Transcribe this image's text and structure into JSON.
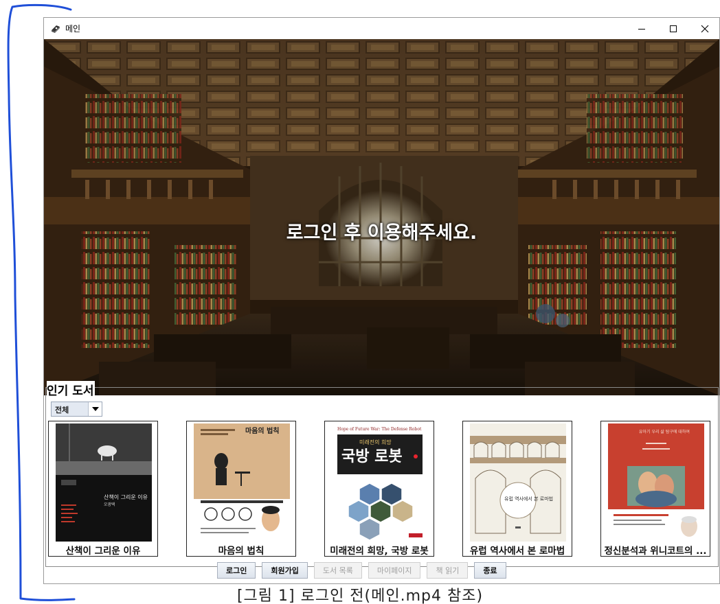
{
  "window": {
    "title": "메인"
  },
  "hero": {
    "message": "로그인 후 이용해주세요."
  },
  "popular": {
    "legend": "인기 도서",
    "filter": {
      "selected": "전체"
    },
    "books": [
      {
        "title": "산책이 그리운 이유"
      },
      {
        "title": "마음의 법칙"
      },
      {
        "title": "미래전의 희망, 국방 로봇"
      },
      {
        "title": "유럽 역사에서 본 로마법"
      },
      {
        "title": "정신분석과 위니코트의 ..."
      }
    ],
    "covers": {
      "book1": {
        "title": "산책이 그리운 이유",
        "author": "오광택"
      },
      "book2": {
        "title": "마음의 법칙"
      },
      "book3": {
        "header": "Hope of Future War: The Defense Robot",
        "small_title": "미래전의 희망",
        "title": "국방 로봇"
      },
      "book4": {
        "title": "유럽 역사에서 본 로마법"
      },
      "book5": {
        "header": "유아기 우리 삶 탐구에 대하여"
      }
    }
  },
  "buttons": {
    "login": "로그인",
    "signup": "회원가입",
    "book_list": "도서 목록",
    "mypage": "마이페이지",
    "read_book": "책 읽기",
    "exit": "종료"
  },
  "caption": "[그림 1] 로그인 전(메인.mp4 참조)"
}
